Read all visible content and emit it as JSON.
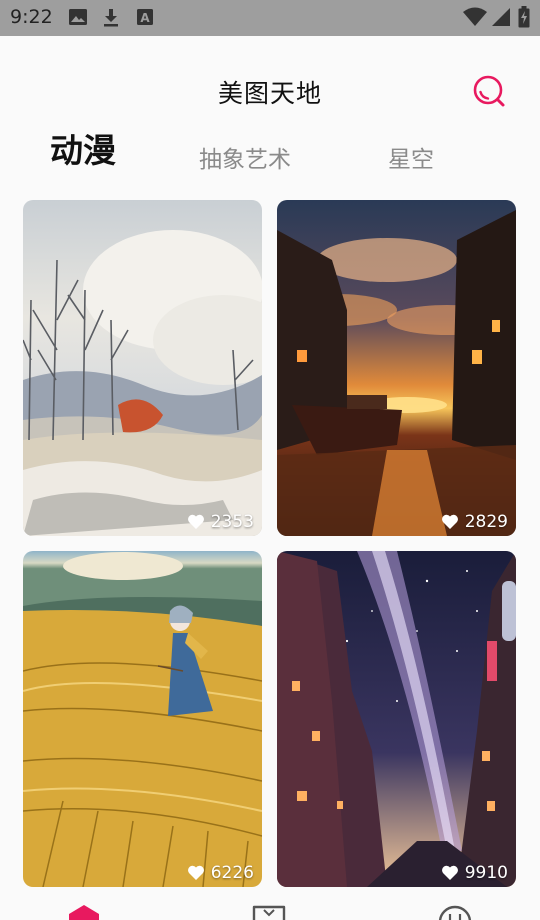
{
  "status_bar": {
    "time": "9:22",
    "icons": [
      "image-icon",
      "download-icon",
      "a-badge-icon",
      "wifi-icon",
      "signal-icon",
      "battery-charging-icon"
    ]
  },
  "app_bar": {
    "title": "美图天地",
    "search_icon": "search-icon",
    "accent_color": "#e8195f"
  },
  "tabs": [
    {
      "label": "动漫",
      "active": true
    },
    {
      "label": "抽象艺术",
      "active": false
    },
    {
      "label": "星空",
      "active": false
    }
  ],
  "cards": [
    {
      "likes": "2353",
      "subject": "winter landscape with bare trees"
    },
    {
      "likes": "2829",
      "subject": "boat in canal at sunset"
    },
    {
      "likes": "6226",
      "subject": "girl in golden wheat field"
    },
    {
      "likes": "9910",
      "subject": "city street under milky way"
    }
  ],
  "bottom_nav": [
    {
      "icon": "home-icon",
      "active": true
    },
    {
      "icon": "category-icon",
      "active": false
    },
    {
      "icon": "profile-icon",
      "active": false
    }
  ]
}
